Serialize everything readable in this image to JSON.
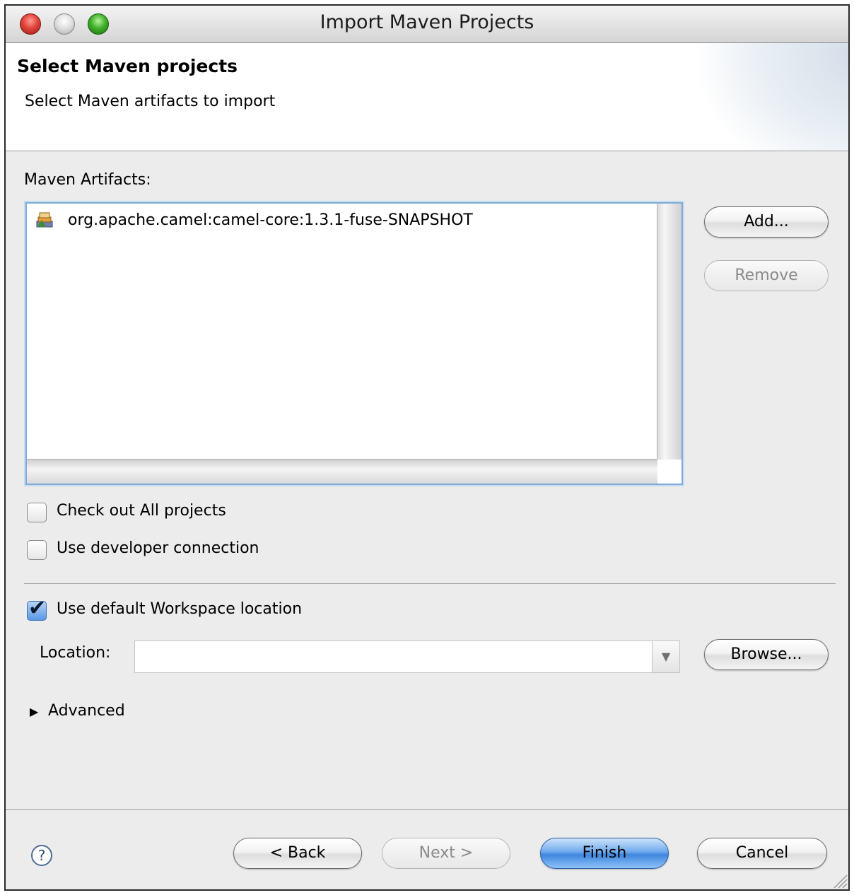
{
  "window": {
    "title": "Import Maven Projects"
  },
  "header": {
    "title": "Select Maven projects",
    "subtitle": "Select Maven artifacts to import"
  },
  "artifacts": {
    "label": "Maven Artifacts:",
    "items": [
      {
        "name": "org.apache.camel:camel-core:1.3.1-fuse-SNAPSHOT",
        "icon": "maven-artifact-icon"
      }
    ],
    "add_label": "Add...",
    "remove_label": "Remove"
  },
  "options": {
    "checkout_all": {
      "label": "Check out All projects",
      "checked": false
    },
    "developer_connection": {
      "label": "Use developer connection",
      "checked": false
    },
    "default_workspace": {
      "label": "Use default Workspace location",
      "checked": true
    }
  },
  "location": {
    "label": "Location:",
    "value": "",
    "browse_label": "Browse..."
  },
  "advanced": {
    "label": "Advanced",
    "expanded": false
  },
  "footer": {
    "back_label": "< Back",
    "next_label": "Next >",
    "finish_label": "Finish",
    "cancel_label": "Cancel"
  },
  "colors": {
    "accent": "#5a98e4",
    "focus_ring": "#7eabd8"
  }
}
